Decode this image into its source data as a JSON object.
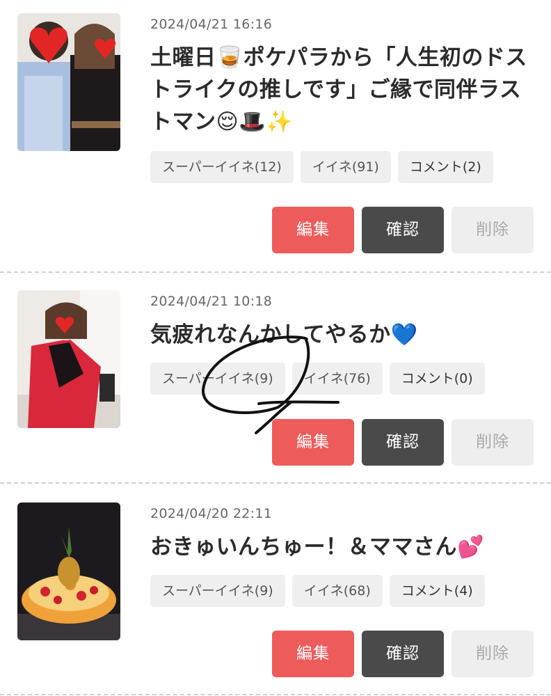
{
  "posts": [
    {
      "date": "2024/04/21 16:16",
      "title": "土曜日🥃ポケパラから「人生初のドストライクの推しです」ご縁で同伴ラストマン😌🎩✨",
      "super_like": "スーパーイイネ(12)",
      "like": "イイネ(91)",
      "comment": "コメント(2)",
      "edit": "編集",
      "confirm": "確認",
      "delete": "削除"
    },
    {
      "date": "2024/04/21 10:18",
      "title": "気疲れなんかしてやるか💙",
      "super_like": "スーパーイイネ(9)",
      "like": "イイネ(76)",
      "comment": "コメント(0)",
      "edit": "編集",
      "confirm": "確認",
      "delete": "削除"
    },
    {
      "date": "2024/04/20 22:11",
      "title": "おきゅいんちゅー！＆ママさん💕",
      "super_like": "スーパーイイネ(9)",
      "like": "イイネ(68)",
      "comment": "コメント(4)",
      "edit": "編集",
      "confirm": "確認",
      "delete": "削除"
    }
  ],
  "colors": {
    "edit": "#ee5b5b",
    "confirm": "#4a4a4a",
    "delete_bg": "#eeeeee",
    "chip_bg": "#efefef"
  }
}
